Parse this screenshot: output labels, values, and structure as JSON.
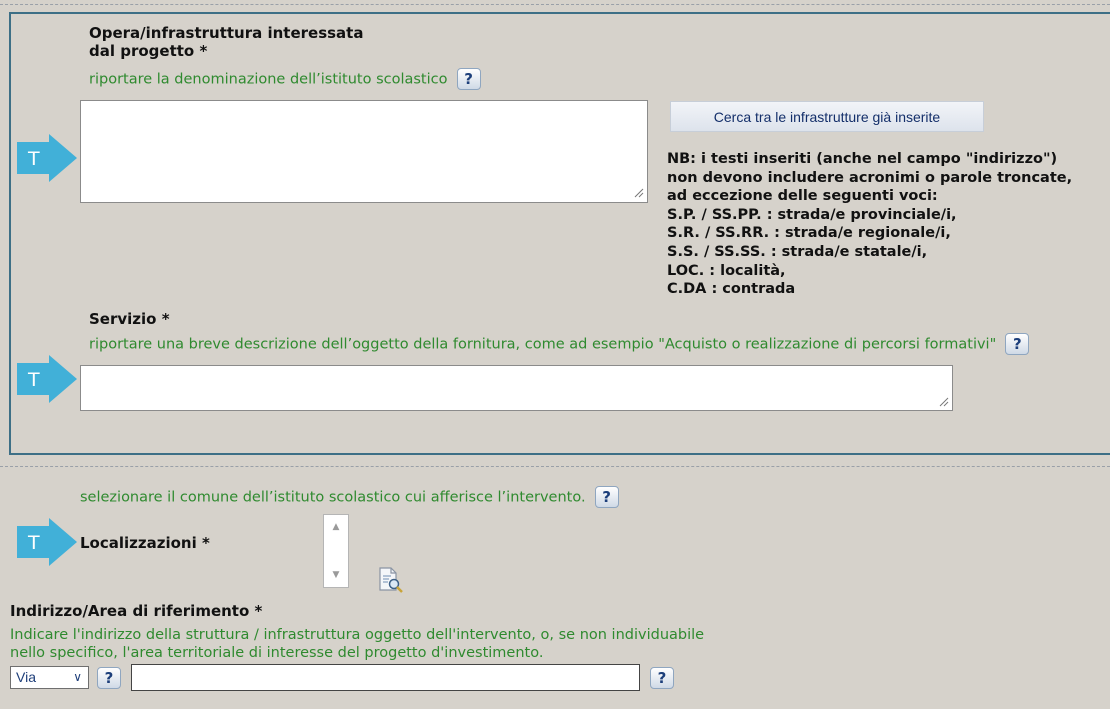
{
  "section_project": {
    "opera_label_line1": "Opera/infrastruttura interessata",
    "opera_label_line2": "dal progetto *",
    "opera_hint": "riportare la denominazione dell’istituto scolastico",
    "opera_value": "",
    "search_button": "Cerca tra le infrastrutture già inserite",
    "nb_lines": [
      "NB: i testi inseriti (anche nel campo \"indirizzo\")",
      "non devono includere acronimi o parole troncate,",
      "ad eccezione delle seguenti voci:",
      "S.P. / SS.PP. : strada/e provinciale/i,",
      "S.R. / SS.RR. : strada/e regionale/i,",
      "S.S. / SS.SS. : strada/e statale/i,",
      "LOC. : località,",
      "C.DA : contrada"
    ],
    "servizio_label": "Servizio *",
    "servizio_hint": "riportare una breve descrizione dell’oggetto della fornitura, come ad esempio \"Acquisto o realizzazione di percorsi formativi\"",
    "servizio_value": ""
  },
  "section_location": {
    "comune_hint": "selezionare il comune dell’istituto scolastico cui afferisce l’intervento.",
    "localizzazioni_label": "Localizzazioni *",
    "indirizzo_label": "Indirizzo/Area di riferimento *",
    "indirizzo_hint_line1": "Indicare l'indirizzo della struttura / infrastruttura oggetto dell'intervento, o, se non individuabile",
    "indirizzo_hint_line2": "nello specifico, l'area territoriale di interesse del progetto d'investimento.",
    "street_type_selected": "Via",
    "address_value": ""
  },
  "common": {
    "help_glyph": "?",
    "text_marker": "T",
    "arrow_color": "#41b0d8"
  }
}
